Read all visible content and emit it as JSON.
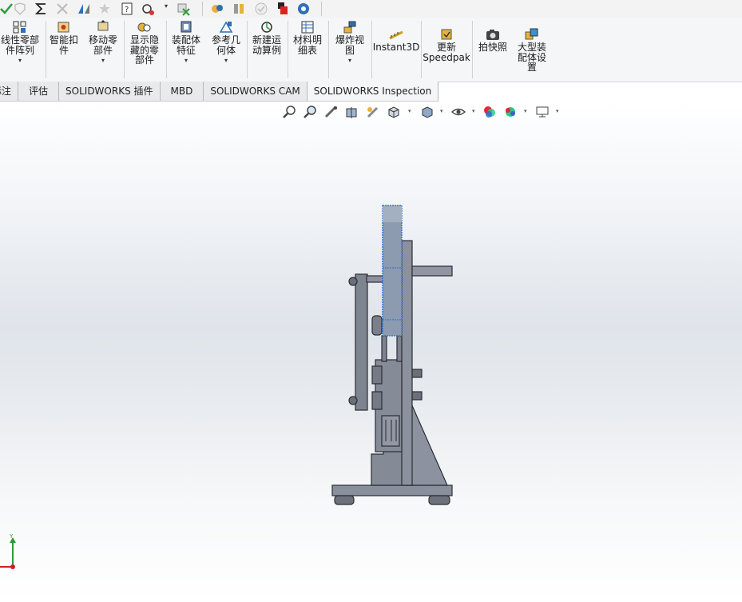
{
  "ribbon": {
    "buttons": [
      {
        "id": "linear-pattern",
        "label": "线性零部\n件阵列",
        "icon": "linear-pattern-icon"
      },
      {
        "id": "smart-fastener",
        "label": "智能扣\n件",
        "icon": "smart-fastener-icon"
      },
      {
        "id": "move-component",
        "label": "移动零\n部件",
        "icon": "move-component-icon"
      },
      {
        "id": "show-hidden",
        "label": "显示隐\n藏的零\n部件",
        "icon": "show-hidden-icon"
      },
      {
        "id": "assembly-features",
        "label": "装配体\n特征",
        "icon": "assembly-feature-icon"
      },
      {
        "id": "reference-geometry",
        "label": "参考几\n何体",
        "icon": "reference-geometry-icon"
      },
      {
        "id": "new-motion-study",
        "label": "新建运\n动算例",
        "icon": "motion-study-icon"
      },
      {
        "id": "bom",
        "label": "材料明\n细表",
        "icon": "bom-icon"
      },
      {
        "id": "exploded-view",
        "label": "爆炸视\n图",
        "icon": "exploded-view-icon"
      },
      {
        "id": "instant3d",
        "label": "Instant3D",
        "icon": "instant3d-icon"
      },
      {
        "id": "update-speedpak",
        "label": "更新\nSpeedpak",
        "icon": "speedpak-icon"
      },
      {
        "id": "snapshot",
        "label": "拍快照",
        "icon": "camera-icon"
      },
      {
        "id": "large-assembly",
        "label": "大型装\n配体设\n置",
        "icon": "large-assembly-icon"
      }
    ]
  },
  "tabs": [
    "标注",
    "评估",
    "SOLIDWORKS 插件",
    "MBD",
    "SOLIDWORKS CAM",
    "SOLIDWORKS Inspection"
  ],
  "triad": {
    "y_label": "Y"
  },
  "colors": {
    "part": "#8a8f9c",
    "part_dark": "#5a5e69",
    "edge": "#2b2d33",
    "selected": "#8d9bb0",
    "selected_edge": "#2a6fc9"
  }
}
